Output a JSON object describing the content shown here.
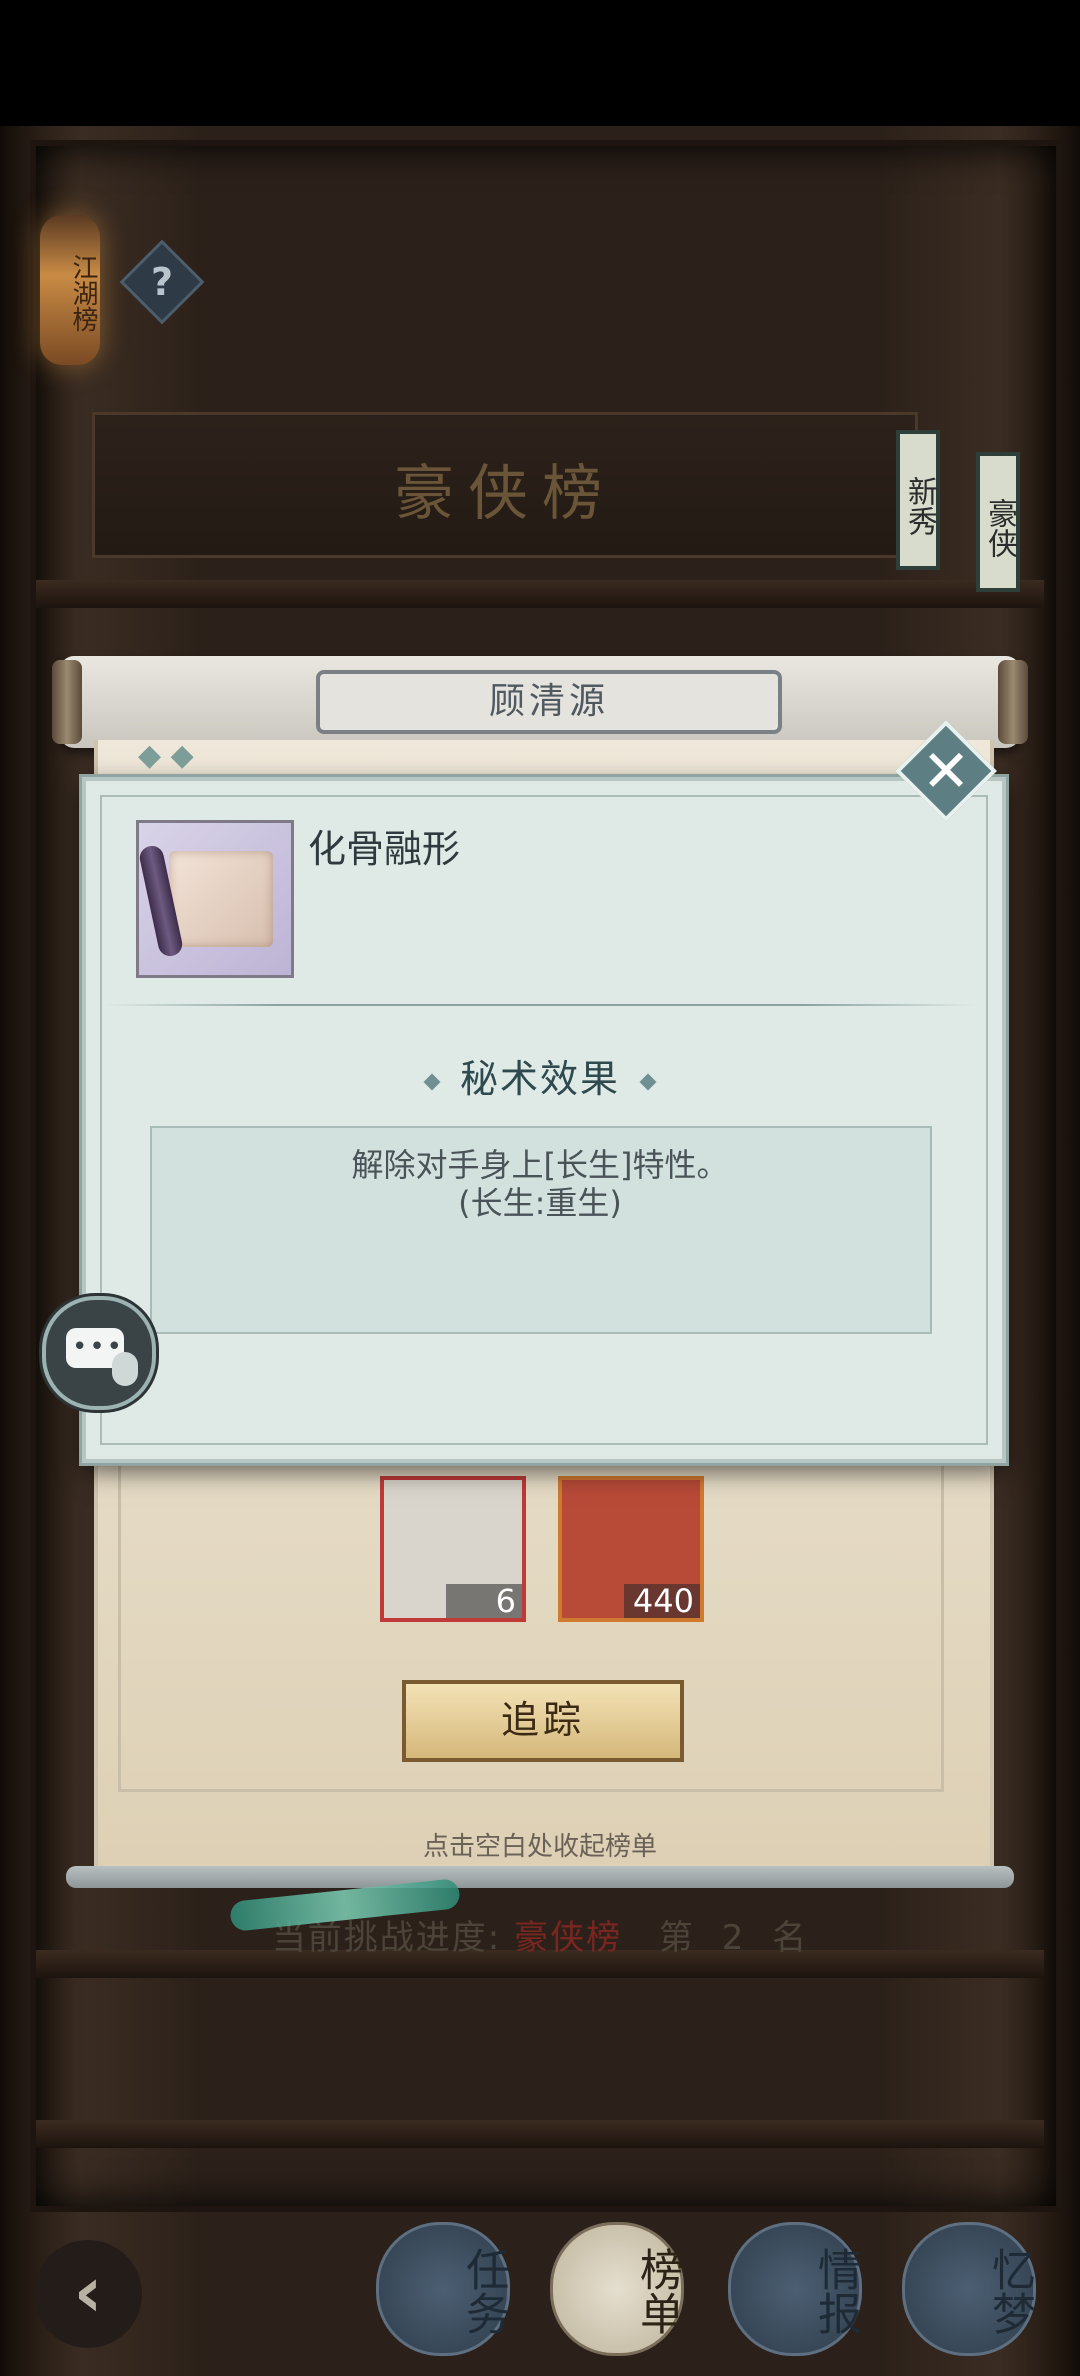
{
  "colors": {
    "dialog_bg": "#dfeae7",
    "accent_red": "#7a2620",
    "button_gold": "#d5b87a"
  },
  "lantern": {
    "text": "江湖榜"
  },
  "help": {
    "icon": "question-icon",
    "symbol": "?"
  },
  "header": {
    "title": "豪侠榜",
    "tags": [
      "新秀",
      "豪侠"
    ]
  },
  "scroll": {
    "character_name": "顾清源"
  },
  "dialog": {
    "close_symbol": "✕",
    "item_name": "化骨融形",
    "section_title": "秘术效果",
    "effect_line1": "解除对手身上[长生]特性。",
    "effect_line2": "(长生:重生)"
  },
  "rewards": [
    {
      "name": "jiu-zhang-paper",
      "count": "6"
    },
    {
      "name": "reputation-scroll",
      "count": "440"
    }
  ],
  "track_button": {
    "label": "追踪"
  },
  "hint": {
    "text": "点击空白处收起榜单"
  },
  "progress": {
    "prefix": "当前挑战进度:",
    "list_name": "豪侠榜",
    "rank_prefix": "第",
    "rank": "2",
    "rank_suffix": "名"
  },
  "bottom_nav": {
    "back_symbol": "‹",
    "items": [
      {
        "label": "任务",
        "active": false
      },
      {
        "label": "榜单",
        "active": true
      },
      {
        "label": "情报",
        "active": false
      },
      {
        "label": "忆梦",
        "active": false
      }
    ]
  }
}
